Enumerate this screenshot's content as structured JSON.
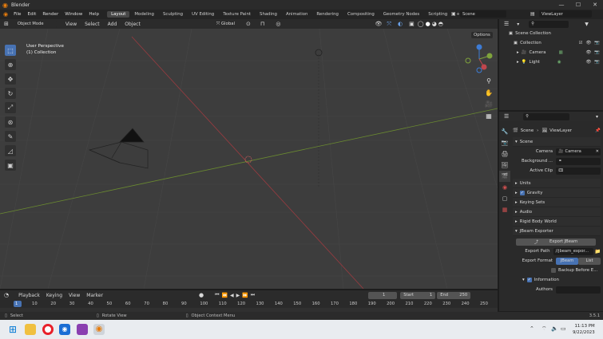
{
  "window": {
    "title": "Blender",
    "minimize": "—",
    "maximize": "☐",
    "close": "✕"
  },
  "menu": {
    "items": [
      "File",
      "Edit",
      "Render",
      "Window",
      "Help"
    ],
    "workspaces": [
      "Layout",
      "Modeling",
      "Sculpting",
      "UV Editing",
      "Texture Paint",
      "Shading",
      "Animation",
      "Rendering",
      "Compositing",
      "Geometry Nodes",
      "Scripting"
    ],
    "add_workspace": "+",
    "scene": "Scene",
    "view_layer": "ViewLayer"
  },
  "viewport_header": {
    "mode": "Object Mode",
    "menus": [
      "View",
      "Select",
      "Add",
      "Object"
    ],
    "transform_orientation": "Global",
    "options": "Options"
  },
  "viewport": {
    "overlay_line1": "User Perspective",
    "overlay_line2": "(1) Collection",
    "gizmo_x": "X",
    "gizmo_y": "Y",
    "gizmo_z": "Z"
  },
  "outliner": {
    "root": "Scene Collection",
    "collection": "Collection",
    "items": [
      "Camera",
      "Light"
    ]
  },
  "properties": {
    "breadcrumb_scene": "Scene",
    "breadcrumb_view_layer": "ViewLayer",
    "scene_section": "Scene",
    "camera_label": "Camera",
    "camera_value": "Camera",
    "background_label": "Background ...",
    "active_clip_label": "Active Clip",
    "collapsed_sections": [
      "Units",
      "Gravity",
      "Keying Sets",
      "Audio",
      "Rigid Body World"
    ],
    "jbeam_section": "JBeam Exporter",
    "export_button": "Export JBeam",
    "export_path_label": "Export Path",
    "export_path_value": "//jbeam_expor...",
    "export_format_label": "Export Format",
    "format_options": [
      "JBeam",
      "List"
    ],
    "backup_label": "Backup Before E...",
    "information_label": "Information",
    "authors_label": "Authors"
  },
  "timeline": {
    "menus": [
      "Playback",
      "Keying",
      "View",
      "Marker"
    ],
    "current_frame": "1",
    "start_label": "Start",
    "start_value": "1",
    "end_label": "End",
    "end_value": "250",
    "ruler": [
      "1",
      "10",
      "20",
      "30",
      "40",
      "50",
      "60",
      "70",
      "80",
      "90",
      "100",
      "110",
      "120",
      "130",
      "140",
      "150",
      "160",
      "170",
      "180",
      "190",
      "200",
      "210",
      "220",
      "230",
      "240",
      "250"
    ]
  },
  "status_bar": {
    "select": "Select",
    "rotate_view": "Rotate View",
    "context_menu": "Object Context Menu",
    "version": "3.5.1"
  },
  "taskbar": {
    "time": "11:13 PM",
    "date": "9/22/2023"
  },
  "colors": {
    "accent": "#4772b3",
    "x_axis": "#c0464d",
    "y_axis": "#7fa33c",
    "z_axis": "#3d7bd4"
  }
}
